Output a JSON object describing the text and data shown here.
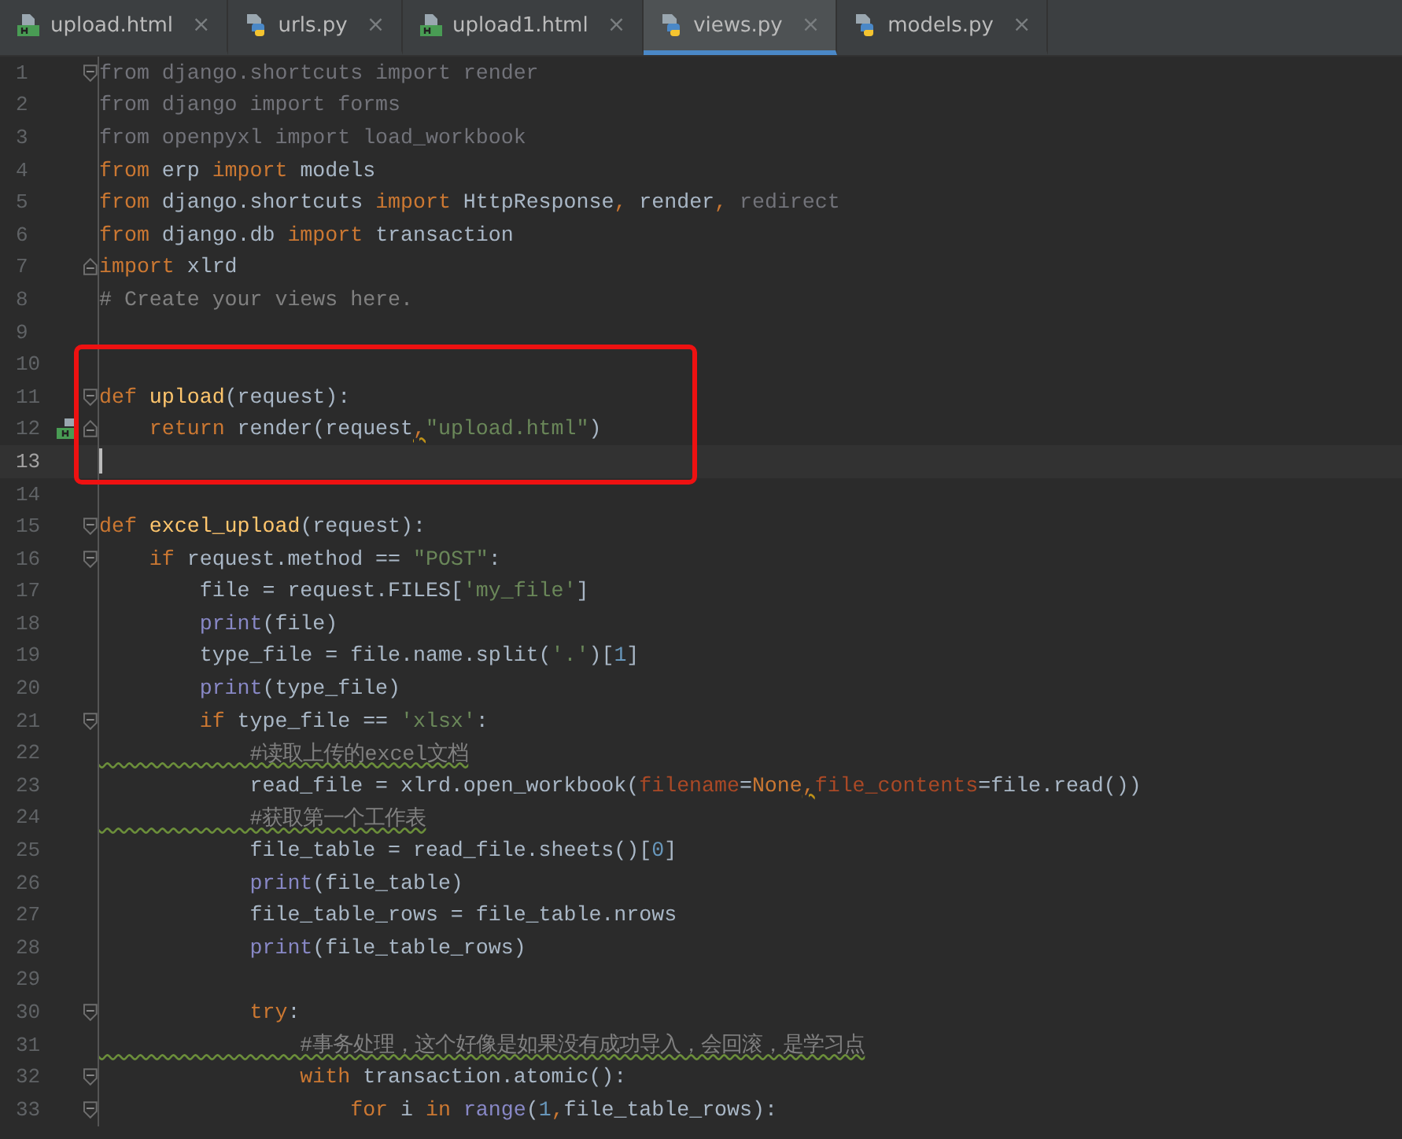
{
  "tabs": [
    {
      "label": "upload.html",
      "kind": "html",
      "selected": false,
      "close": "×"
    },
    {
      "label": "urls.py",
      "kind": "python",
      "selected": false,
      "close": "×"
    },
    {
      "label": "upload1.html",
      "kind": "html",
      "selected": false,
      "close": "×"
    },
    {
      "label": "views.py",
      "kind": "python",
      "selected": true,
      "close": "×"
    },
    {
      "label": "models.py",
      "kind": "python",
      "selected": false,
      "close": "×"
    }
  ],
  "editor": {
    "lines": [
      {
        "n": "1",
        "kind": "fold-start",
        "boxed": false,
        "tokens": [
          {
            "kind": "dim",
            "t": "from django.shortcuts import render"
          }
        ]
      },
      {
        "n": "2",
        "kind": "code",
        "boxed": false,
        "tokens": [
          {
            "kind": "dim",
            "t": "from django import forms"
          }
        ]
      },
      {
        "n": "3",
        "kind": "code",
        "boxed": false,
        "tokens": [
          {
            "kind": "dim",
            "t": "from openpyxl import load_workbook"
          }
        ]
      },
      {
        "n": "4",
        "kind": "code",
        "boxed": false,
        "tokens": [
          {
            "kind": "kw",
            "t": "from "
          },
          {
            "kind": "plain",
            "t": "erp "
          },
          {
            "kind": "kw",
            "t": "import "
          },
          {
            "kind": "plain",
            "t": "models"
          }
        ]
      },
      {
        "n": "5",
        "kind": "code",
        "boxed": false,
        "tokens": [
          {
            "kind": "kw",
            "t": "from "
          },
          {
            "kind": "plain",
            "t": "django.shortcuts "
          },
          {
            "kind": "kw",
            "t": "import "
          },
          {
            "kind": "plain",
            "t": "HttpResponse"
          },
          {
            "kind": "kw",
            "t": ", "
          },
          {
            "kind": "plain",
            "t": "render"
          },
          {
            "kind": "kw",
            "t": ", "
          },
          {
            "kind": "dim",
            "t": "redirect"
          }
        ]
      },
      {
        "n": "6",
        "kind": "code",
        "boxed": false,
        "tokens": [
          {
            "kind": "kw",
            "t": "from "
          },
          {
            "kind": "plain",
            "t": "django.db "
          },
          {
            "kind": "kw",
            "t": "import "
          },
          {
            "kind": "plain",
            "t": "transaction"
          }
        ]
      },
      {
        "n": "7",
        "kind": "fold-end",
        "boxed": false,
        "tokens": [
          {
            "kind": "kw",
            "t": "import "
          },
          {
            "kind": "plain",
            "t": "xlrd"
          }
        ]
      },
      {
        "n": "8",
        "kind": "code",
        "boxed": false,
        "tokens": [
          {
            "kind": "comment",
            "t": "# Create your views here."
          }
        ]
      },
      {
        "n": "9",
        "kind": "code",
        "boxed": false
      },
      {
        "n": "10",
        "kind": "code",
        "boxed": true
      },
      {
        "n": "11",
        "kind": "fold-start",
        "boxed": true,
        "tokens": [
          {
            "kind": "kw",
            "t": "def "
          },
          {
            "kind": "def",
            "t": "upload"
          },
          {
            "kind": "plain",
            "t": "(request):"
          }
        ]
      },
      {
        "n": "12",
        "kind": "fold-end-template",
        "boxed": true,
        "tokens": [
          {
            "kind": "kw",
            "t": "    return "
          },
          {
            "kind": "plain",
            "t": "render(request"
          },
          {
            "kind": "warn",
            "t": ","
          },
          {
            "kind": "str",
            "t": "\"upload.html\""
          },
          {
            "kind": "plain",
            "t": ")"
          }
        ]
      },
      {
        "n": "13",
        "kind": "caret",
        "boxed": true
      },
      {
        "n": "14",
        "kind": "code",
        "boxed": false
      },
      {
        "n": "15",
        "kind": "fold-start",
        "boxed": false,
        "tokens": [
          {
            "kind": "kw",
            "t": "def "
          },
          {
            "kind": "def",
            "t": "excel_upload"
          },
          {
            "kind": "plain",
            "t": "(request):"
          }
        ]
      },
      {
        "n": "16",
        "kind": "fold-start",
        "boxed": false,
        "tokens": [
          {
            "kind": "kw",
            "t": "    if "
          },
          {
            "kind": "plain",
            "t": "request.method == "
          },
          {
            "kind": "str",
            "t": "\"POST\""
          },
          {
            "kind": "plain",
            "t": ":"
          }
        ]
      },
      {
        "n": "17",
        "kind": "code",
        "boxed": false,
        "tokens": [
          {
            "kind": "plain",
            "t": "        file = request.FILES["
          },
          {
            "kind": "str",
            "t": "'my_file'"
          },
          {
            "kind": "plain",
            "t": "]"
          }
        ]
      },
      {
        "n": "18",
        "kind": "code",
        "boxed": false,
        "tokens": [
          {
            "kind": "builtin",
            "t": "        print"
          },
          {
            "kind": "plain",
            "t": "(file)"
          }
        ]
      },
      {
        "n": "19",
        "kind": "code",
        "boxed": false,
        "tokens": [
          {
            "kind": "plain",
            "t": "        type_file = file.name.split("
          },
          {
            "kind": "str",
            "t": "'.'"
          },
          {
            "kind": "plain",
            "t": ")["
          },
          {
            "kind": "num",
            "t": "1"
          },
          {
            "kind": "plain",
            "t": "]"
          }
        ]
      },
      {
        "n": "20",
        "kind": "code",
        "boxed": false,
        "tokens": [
          {
            "kind": "builtin",
            "t": "        print"
          },
          {
            "kind": "plain",
            "t": "(type_file)"
          }
        ]
      },
      {
        "n": "21",
        "kind": "fold-start",
        "boxed": false,
        "tokens": [
          {
            "kind": "kw",
            "t": "        if "
          },
          {
            "kind": "plain",
            "t": "type_file == "
          },
          {
            "kind": "str",
            "t": "'xlsx'"
          },
          {
            "kind": "plain",
            "t": ":"
          }
        ]
      },
      {
        "n": "22",
        "kind": "code",
        "boxed": false,
        "tokens": [
          {
            "kind": "typo",
            "t": "            #读取上传的excel文档"
          }
        ]
      },
      {
        "n": "23",
        "kind": "code",
        "boxed": false,
        "tokens": [
          {
            "kind": "plain",
            "t": "            read_file = xlrd.open_workbook("
          },
          {
            "kind": "kwarg",
            "t": "filename"
          },
          {
            "kind": "plain",
            "t": "="
          },
          {
            "kind": "kw",
            "t": "None"
          },
          {
            "kind": "warn",
            "t": ","
          },
          {
            "kind": "kwarg",
            "t": "file_contents"
          },
          {
            "kind": "plain",
            "t": "=file.read())"
          }
        ]
      },
      {
        "n": "24",
        "kind": "code",
        "boxed": false,
        "tokens": [
          {
            "kind": "typo",
            "t": "            #获取第一个工作表"
          }
        ]
      },
      {
        "n": "25",
        "kind": "code",
        "boxed": false,
        "tokens": [
          {
            "kind": "plain",
            "t": "            file_table = read_file.sheets()["
          },
          {
            "kind": "num",
            "t": "0"
          },
          {
            "kind": "plain",
            "t": "]"
          }
        ]
      },
      {
        "n": "26",
        "kind": "code",
        "boxed": false,
        "tokens": [
          {
            "kind": "builtin",
            "t": "            print"
          },
          {
            "kind": "plain",
            "t": "(file_table)"
          }
        ]
      },
      {
        "n": "27",
        "kind": "code",
        "boxed": false,
        "tokens": [
          {
            "kind": "plain",
            "t": "            file_table_rows = file_table.nrows"
          }
        ]
      },
      {
        "n": "28",
        "kind": "code",
        "boxed": false,
        "tokens": [
          {
            "kind": "builtin",
            "t": "            print"
          },
          {
            "kind": "plain",
            "t": "(file_table_rows)"
          }
        ]
      },
      {
        "n": "29",
        "kind": "code",
        "boxed": false
      },
      {
        "n": "30",
        "kind": "fold-start",
        "boxed": false,
        "tokens": [
          {
            "kind": "kw",
            "t": "            try"
          },
          {
            "kind": "plain",
            "t": ":"
          }
        ]
      },
      {
        "n": "31",
        "kind": "code",
        "boxed": false,
        "tokens": [
          {
            "kind": "typo",
            "t": "                #事务处理，这个好像是如果没有成功导入，会回滚，是学习点"
          }
        ]
      },
      {
        "n": "32",
        "kind": "fold-start",
        "boxed": false,
        "tokens": [
          {
            "kind": "kw",
            "t": "                with "
          },
          {
            "kind": "plain",
            "t": "transaction.atomic():"
          }
        ]
      },
      {
        "n": "33",
        "kind": "fold-start",
        "boxed": false,
        "tokens": [
          {
            "kind": "kw",
            "t": "                    for "
          },
          {
            "kind": "plain",
            "t": "i "
          },
          {
            "kind": "kw",
            "t": "in "
          },
          {
            "kind": "builtin",
            "t": "range"
          },
          {
            "kind": "plain",
            "t": "("
          },
          {
            "kind": "num",
            "t": "1"
          },
          {
            "kind": "kw",
            "t": ","
          },
          {
            "kind": "plain",
            "t": "file_table_rows):"
          }
        ]
      }
    ]
  }
}
